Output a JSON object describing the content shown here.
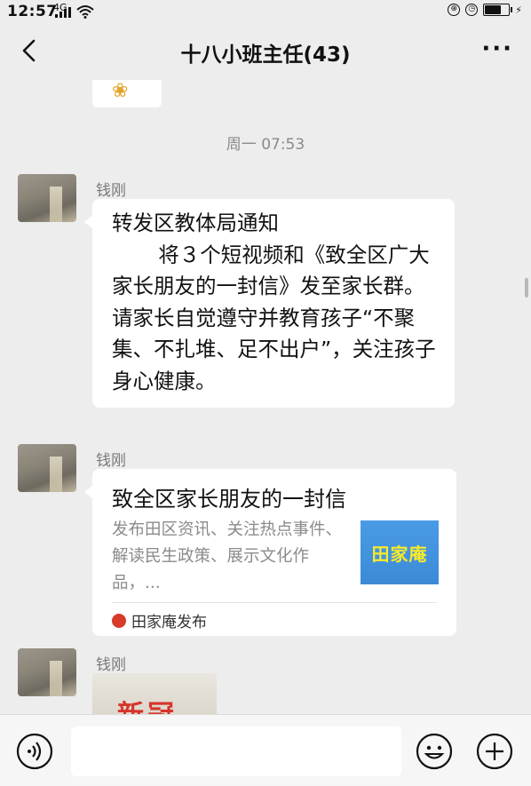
{
  "status_bar": {
    "time": "12:57",
    "network": "4G",
    "icons": [
      "signal-icon",
      "wifi-icon",
      "lock-rotation-icon",
      "alarm-icon",
      "battery-icon"
    ],
    "battery_level": 0.7
  },
  "header": {
    "title": "十八小班主任(43)",
    "back_icon": "back-chevron-icon",
    "more_label": "···"
  },
  "messages": {
    "top_partial": {
      "sticker": "sticker-icon"
    },
    "timestamp": "周一 07:53",
    "msg1": {
      "sender": "钱刚",
      "text": "转发区教体局通知\n       将３个短视频和《致全区广大家长朋友的一封信》发至家长群。请家长自觉遵守并教育孩子“不聚集、不扎堆、足不出户”，关注孩子身心健康。"
    },
    "msg2": {
      "sender": "钱刚",
      "card_title": "致全区家长朋友的一封信",
      "card_desc": "发布田区资讯、关注热点事件、解读民生政策、展示文化作品，...",
      "thumb_text": "田家庵",
      "source": "田家庵发布"
    },
    "msg3": {
      "sender": "钱刚",
      "image_text": "新冠"
    }
  },
  "input_bar": {
    "voice_icon": "voice-icon",
    "emoji_icon": "emoji-icon",
    "plus_icon": "plus-icon",
    "input_value": ""
  }
}
